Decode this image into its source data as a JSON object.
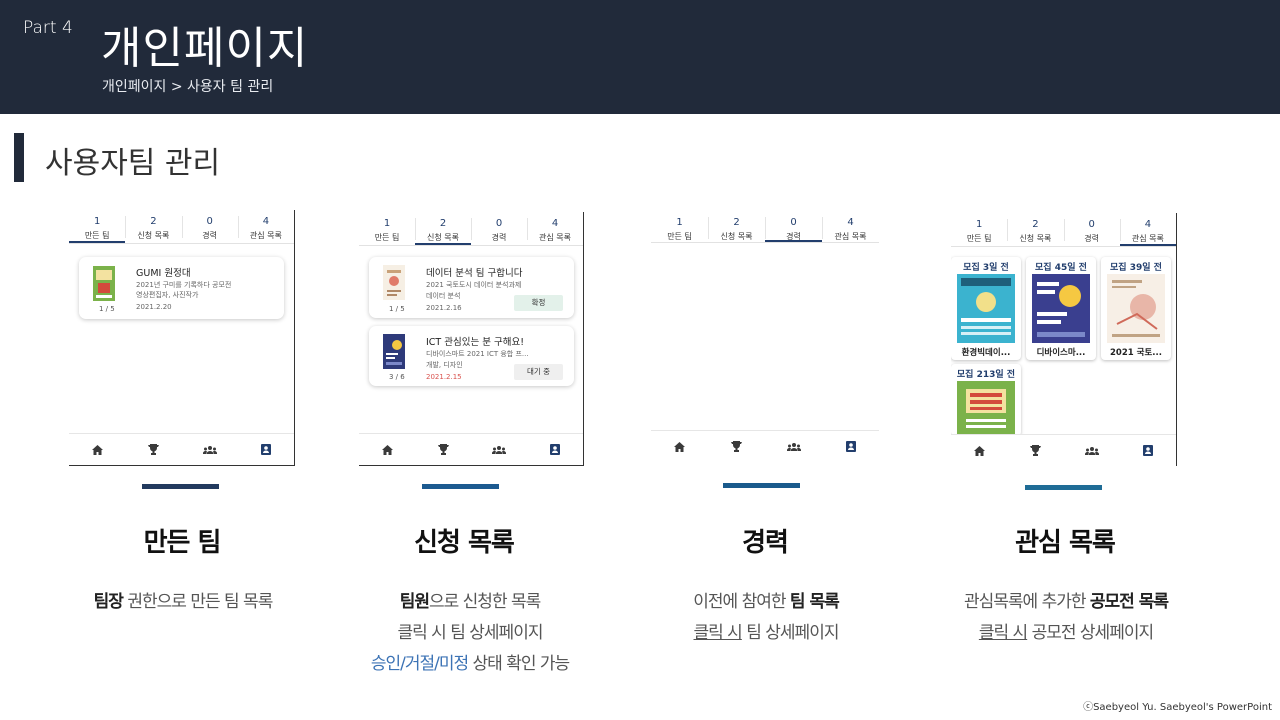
{
  "header": {
    "part": "Part 4",
    "title": "개인페이지",
    "breadcrumb": "개인페이지 > 사용자 팀 관리"
  },
  "section": {
    "title": "사용자팀 관리"
  },
  "tabs": [
    {
      "num": "1",
      "label": "만든 팀"
    },
    {
      "num": "2",
      "label": "신청 목록"
    },
    {
      "num": "0",
      "label": "경력"
    },
    {
      "num": "4",
      "label": "관심 목록"
    }
  ],
  "screen1": {
    "card": {
      "title": "GUMI 원정대",
      "line1": "2021년 구미를 기록하다 공모전",
      "line2": "영상편집자, 사진작가",
      "date": "2021.2.20",
      "count": "1 / 5"
    }
  },
  "screen2": {
    "cards": [
      {
        "title": "데이터 분석 팀 구합니다",
        "line1": "2021 국토도시 데이터 분석과제",
        "line2": "데이터 분석",
        "date": "2021.2.16",
        "count": "1 / 5",
        "status": "확정"
      },
      {
        "title": "ICT 관심있는 분 구해요!",
        "line1": "디바이스마트 2021 ICT 융합 프...",
        "line2": "개발, 디자인",
        "date": "2021.2.15",
        "count": "3 / 6",
        "status": "대기 중"
      }
    ]
  },
  "screen4": {
    "posters": [
      {
        "head": "모집 3일 전",
        "name": "환경빅데이..."
      },
      {
        "head": "모집 45일 전",
        "name": "디바이스마..."
      },
      {
        "head": "모집 39일 전",
        "name": "2021 국토..."
      },
      {
        "head": "모집 213일 전",
        "name": ""
      }
    ]
  },
  "columns": [
    {
      "title": "만든 팀",
      "desc1_bold": "팀장",
      "desc1_rest": " 권한으로 만든 팀 목록"
    },
    {
      "title": "신청 목록",
      "desc1_bold": "팀원",
      "desc1_rest": "으로 신청한 목록",
      "desc2": "클릭 시 팀 상세페이지",
      "desc3_a": "승인",
      "desc3_sep1": "/",
      "desc3_b": "거절",
      "desc3_sep2": "/",
      "desc3_c": "미정",
      "desc3_rest": " 상태 확인 가능"
    },
    {
      "title": "경력",
      "desc1_a": "이전에 참여한 ",
      "desc1_bold": "팀 목록",
      "desc2_u": "클릭 시",
      "desc2_rest": " 팀 상세페이지"
    },
    {
      "title": "관심 목록",
      "desc1_a": "관심목록에 추가한 ",
      "desc1_bold": "공모전 목록",
      "desc2_u": "클릭 시",
      "desc2_rest": " 공모전 상세페이지"
    }
  ],
  "colors": {
    "header_bg": "#212a3a",
    "accent1": "#223a5e",
    "accent2": "#1c5a90",
    "accent3": "#1a5a8c",
    "accent4": "#1f6c96",
    "link_blue": "#3c73b5"
  },
  "copyright": "ⓒSaebyeol Yu. Saebyeol's PowerPoint"
}
